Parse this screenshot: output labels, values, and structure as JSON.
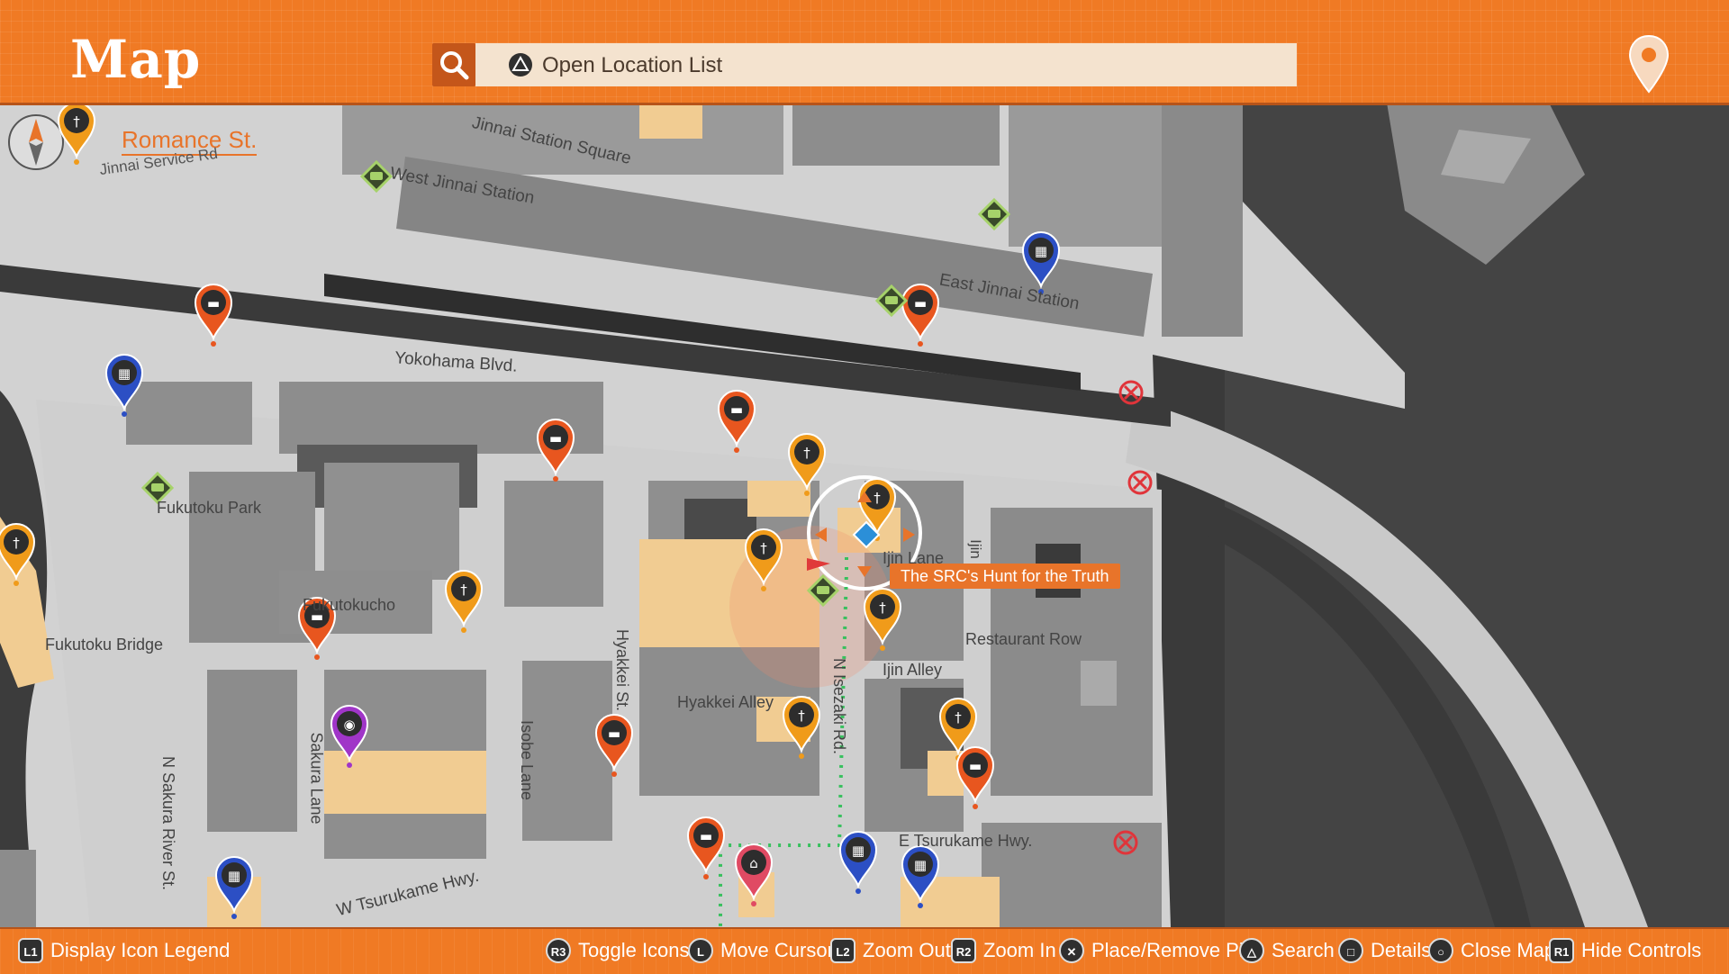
{
  "header": {
    "title": "Map",
    "search_placeholder": "Open Location List",
    "search_icon": "search-icon",
    "triangle_icon": "triangle-button-icon",
    "location_pin_icon": "map-pin-icon"
  },
  "current_location": {
    "label": "Romance St.",
    "icon": "location-pin-icon"
  },
  "streets": {
    "jinnai_service_rd": "Jinnai Service Rd",
    "jinnai_station_square": "Jinnai Station Square",
    "west_jinnai_station": "West Jinnai Station",
    "east_jinnai_station": "East Jinnai Station",
    "yokohama_blvd": "Yokohama Blvd.",
    "fukutoku_park": "Fukutoku Park",
    "fukutokucho": "Fukutokucho",
    "fukutoku_bridge": "Fukutoku Bridge",
    "hyakkei_st": "Hyakkei St.",
    "hyakkei_alley": "Hyakkei Alley",
    "isobe_lane": "Isobe Lane",
    "sakura_lane": "Sakura Lane",
    "n_sakura_river_st": "N Sakura River St.",
    "w_tsurukame_hwy": "W Tsurukame Hwy.",
    "e_tsurukame_hwy": "E Tsurukame Hwy.",
    "n_isezaki_rd": "N Isezaki Rd.",
    "ijin_lane": "Ijin Lane",
    "ijin": "Ijin",
    "ijin_alley": "Ijin Alley",
    "restaurant_row": "Restaurant Row"
  },
  "objective": {
    "label": "The SRC's Hunt for the Truth",
    "accent": "#e8742a"
  },
  "colors": {
    "header_orange": "#f07a24",
    "road": "#cfcfcf",
    "building": "#8f8f8f",
    "highlight": "#f1cc92",
    "water": "#3b3b3b",
    "taxi_pin": "#e8561f",
    "food_pin": "#f09b1a",
    "shop_pin": "#2c4fc4",
    "game_pin": "#a035c8",
    "home_pin": "#e04a63",
    "chat_marker": "#a6d26a"
  },
  "markers": [
    {
      "type": "food",
      "icon": "fork-knife-icon"
    },
    {
      "type": "taxi",
      "icon": "taxi-icon"
    },
    {
      "type": "shop",
      "icon": "shopping-basket-icon"
    },
    {
      "type": "chat",
      "icon": "speech-bubble-icon"
    },
    {
      "type": "game",
      "icon": "game-controller-icon"
    },
    {
      "type": "home",
      "icon": "house-icon"
    },
    {
      "type": "blocked",
      "icon": "x-circle-icon"
    }
  ],
  "footer": {
    "items": [
      {
        "button": "L1",
        "label": "Display Icon Legend"
      },
      {
        "button": "R3",
        "label": "Toggle Icons"
      },
      {
        "button": "L",
        "label": "Move Cursor"
      },
      {
        "button": "L2",
        "label": "Zoom Out"
      },
      {
        "button": "R2",
        "label": "Zoom In"
      },
      {
        "button": "✕",
        "label": "Place/Remove Pin"
      },
      {
        "button": "△",
        "label": "Search"
      },
      {
        "button": "□",
        "label": "Details"
      },
      {
        "button": "○",
        "label": "Close Map"
      },
      {
        "button": "R1",
        "label": "Hide Controls"
      }
    ]
  }
}
